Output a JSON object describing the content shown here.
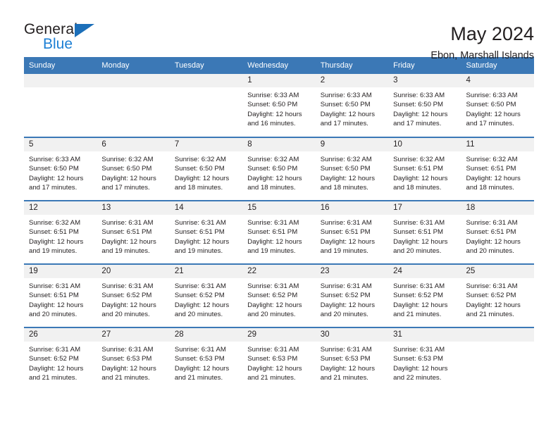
{
  "brand": {
    "name_top": "General",
    "name_bottom": "Blue",
    "triangle_color": "#1c6fb9",
    "blue_text_color": "#1c7fd4"
  },
  "header": {
    "title": "May 2024",
    "subtitle": "Ebon, Marshall Islands",
    "header_bg_color": "#3b78b6",
    "daynum_bg_color": "#f1f1f1"
  },
  "weekday_headers": [
    "Sunday",
    "Monday",
    "Tuesday",
    "Wednesday",
    "Thursday",
    "Friday",
    "Saturday"
  ],
  "labels": {
    "sunrise_prefix": "Sunrise:",
    "sunset_prefix": "Sunset:",
    "daylight_prefix": "Daylight:"
  },
  "weeks": [
    [
      {
        "day": "",
        "empty": true
      },
      {
        "day": "",
        "empty": true
      },
      {
        "day": "",
        "empty": true
      },
      {
        "day": "1",
        "sunrise": "Sunrise: 6:33 AM",
        "sunset": "Sunset: 6:50 PM",
        "daylight_line1": "Daylight: 12 hours",
        "daylight_line2": "and 16 minutes."
      },
      {
        "day": "2",
        "sunrise": "Sunrise: 6:33 AM",
        "sunset": "Sunset: 6:50 PM",
        "daylight_line1": "Daylight: 12 hours",
        "daylight_line2": "and 17 minutes."
      },
      {
        "day": "3",
        "sunrise": "Sunrise: 6:33 AM",
        "sunset": "Sunset: 6:50 PM",
        "daylight_line1": "Daylight: 12 hours",
        "daylight_line2": "and 17 minutes."
      },
      {
        "day": "4",
        "sunrise": "Sunrise: 6:33 AM",
        "sunset": "Sunset: 6:50 PM",
        "daylight_line1": "Daylight: 12 hours",
        "daylight_line2": "and 17 minutes."
      }
    ],
    [
      {
        "day": "5",
        "sunrise": "Sunrise: 6:33 AM",
        "sunset": "Sunset: 6:50 PM",
        "daylight_line1": "Daylight: 12 hours",
        "daylight_line2": "and 17 minutes."
      },
      {
        "day": "6",
        "sunrise": "Sunrise: 6:32 AM",
        "sunset": "Sunset: 6:50 PM",
        "daylight_line1": "Daylight: 12 hours",
        "daylight_line2": "and 17 minutes."
      },
      {
        "day": "7",
        "sunrise": "Sunrise: 6:32 AM",
        "sunset": "Sunset: 6:50 PM",
        "daylight_line1": "Daylight: 12 hours",
        "daylight_line2": "and 18 minutes."
      },
      {
        "day": "8",
        "sunrise": "Sunrise: 6:32 AM",
        "sunset": "Sunset: 6:50 PM",
        "daylight_line1": "Daylight: 12 hours",
        "daylight_line2": "and 18 minutes."
      },
      {
        "day": "9",
        "sunrise": "Sunrise: 6:32 AM",
        "sunset": "Sunset: 6:50 PM",
        "daylight_line1": "Daylight: 12 hours",
        "daylight_line2": "and 18 minutes."
      },
      {
        "day": "10",
        "sunrise": "Sunrise: 6:32 AM",
        "sunset": "Sunset: 6:51 PM",
        "daylight_line1": "Daylight: 12 hours",
        "daylight_line2": "and 18 minutes."
      },
      {
        "day": "11",
        "sunrise": "Sunrise: 6:32 AM",
        "sunset": "Sunset: 6:51 PM",
        "daylight_line1": "Daylight: 12 hours",
        "daylight_line2": "and 18 minutes."
      }
    ],
    [
      {
        "day": "12",
        "sunrise": "Sunrise: 6:32 AM",
        "sunset": "Sunset: 6:51 PM",
        "daylight_line1": "Daylight: 12 hours",
        "daylight_line2": "and 19 minutes."
      },
      {
        "day": "13",
        "sunrise": "Sunrise: 6:31 AM",
        "sunset": "Sunset: 6:51 PM",
        "daylight_line1": "Daylight: 12 hours",
        "daylight_line2": "and 19 minutes."
      },
      {
        "day": "14",
        "sunrise": "Sunrise: 6:31 AM",
        "sunset": "Sunset: 6:51 PM",
        "daylight_line1": "Daylight: 12 hours",
        "daylight_line2": "and 19 minutes."
      },
      {
        "day": "15",
        "sunrise": "Sunrise: 6:31 AM",
        "sunset": "Sunset: 6:51 PM",
        "daylight_line1": "Daylight: 12 hours",
        "daylight_line2": "and 19 minutes."
      },
      {
        "day": "16",
        "sunrise": "Sunrise: 6:31 AM",
        "sunset": "Sunset: 6:51 PM",
        "daylight_line1": "Daylight: 12 hours",
        "daylight_line2": "and 19 minutes."
      },
      {
        "day": "17",
        "sunrise": "Sunrise: 6:31 AM",
        "sunset": "Sunset: 6:51 PM",
        "daylight_line1": "Daylight: 12 hours",
        "daylight_line2": "and 20 minutes."
      },
      {
        "day": "18",
        "sunrise": "Sunrise: 6:31 AM",
        "sunset": "Sunset: 6:51 PM",
        "daylight_line1": "Daylight: 12 hours",
        "daylight_line2": "and 20 minutes."
      }
    ],
    [
      {
        "day": "19",
        "sunrise": "Sunrise: 6:31 AM",
        "sunset": "Sunset: 6:51 PM",
        "daylight_line1": "Daylight: 12 hours",
        "daylight_line2": "and 20 minutes."
      },
      {
        "day": "20",
        "sunrise": "Sunrise: 6:31 AM",
        "sunset": "Sunset: 6:52 PM",
        "daylight_line1": "Daylight: 12 hours",
        "daylight_line2": "and 20 minutes."
      },
      {
        "day": "21",
        "sunrise": "Sunrise: 6:31 AM",
        "sunset": "Sunset: 6:52 PM",
        "daylight_line1": "Daylight: 12 hours",
        "daylight_line2": "and 20 minutes."
      },
      {
        "day": "22",
        "sunrise": "Sunrise: 6:31 AM",
        "sunset": "Sunset: 6:52 PM",
        "daylight_line1": "Daylight: 12 hours",
        "daylight_line2": "and 20 minutes."
      },
      {
        "day": "23",
        "sunrise": "Sunrise: 6:31 AM",
        "sunset": "Sunset: 6:52 PM",
        "daylight_line1": "Daylight: 12 hours",
        "daylight_line2": "and 20 minutes."
      },
      {
        "day": "24",
        "sunrise": "Sunrise: 6:31 AM",
        "sunset": "Sunset: 6:52 PM",
        "daylight_line1": "Daylight: 12 hours",
        "daylight_line2": "and 21 minutes."
      },
      {
        "day": "25",
        "sunrise": "Sunrise: 6:31 AM",
        "sunset": "Sunset: 6:52 PM",
        "daylight_line1": "Daylight: 12 hours",
        "daylight_line2": "and 21 minutes."
      }
    ],
    [
      {
        "day": "26",
        "sunrise": "Sunrise: 6:31 AM",
        "sunset": "Sunset: 6:52 PM",
        "daylight_line1": "Daylight: 12 hours",
        "daylight_line2": "and 21 minutes."
      },
      {
        "day": "27",
        "sunrise": "Sunrise: 6:31 AM",
        "sunset": "Sunset: 6:53 PM",
        "daylight_line1": "Daylight: 12 hours",
        "daylight_line2": "and 21 minutes."
      },
      {
        "day": "28",
        "sunrise": "Sunrise: 6:31 AM",
        "sunset": "Sunset: 6:53 PM",
        "daylight_line1": "Daylight: 12 hours",
        "daylight_line2": "and 21 minutes."
      },
      {
        "day": "29",
        "sunrise": "Sunrise: 6:31 AM",
        "sunset": "Sunset: 6:53 PM",
        "daylight_line1": "Daylight: 12 hours",
        "daylight_line2": "and 21 minutes."
      },
      {
        "day": "30",
        "sunrise": "Sunrise: 6:31 AM",
        "sunset": "Sunset: 6:53 PM",
        "daylight_line1": "Daylight: 12 hours",
        "daylight_line2": "and 21 minutes."
      },
      {
        "day": "31",
        "sunrise": "Sunrise: 6:31 AM",
        "sunset": "Sunset: 6:53 PM",
        "daylight_line1": "Daylight: 12 hours",
        "daylight_line2": "and 22 minutes."
      },
      {
        "day": "",
        "empty": true
      }
    ]
  ]
}
